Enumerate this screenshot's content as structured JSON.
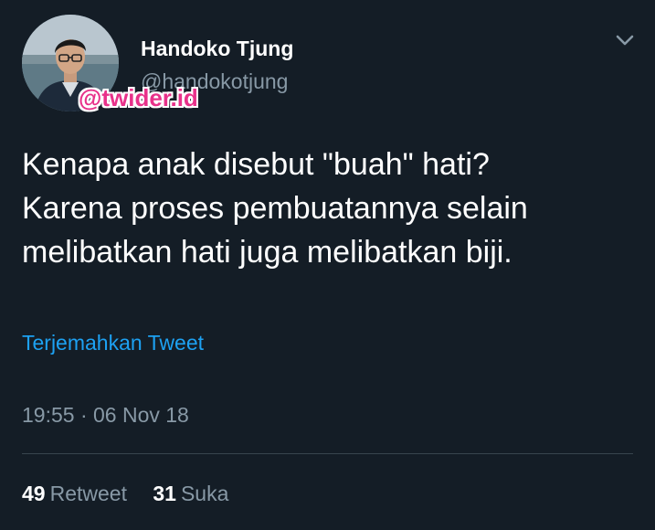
{
  "user": {
    "display_name": "Handoko Tjung",
    "handle": "@handokotjung"
  },
  "watermark": "@twider.id",
  "tweet": {
    "lines": [
      "Kenapa anak disebut \"buah\" hati?",
      "Karena proses pembuatannya selain",
      "melibatkan hati juga melibatkan biji."
    ],
    "translate_label": "Terjemahkan Tweet",
    "timestamp": "19:55 · 06 Nov 18"
  },
  "stats": {
    "retweets_count": "49",
    "retweets_label": "Retweet",
    "likes_count": "31",
    "likes_label": "Suka"
  },
  "icons": {
    "more": "chevron-down-icon"
  },
  "colors": {
    "background": "#141d26",
    "primary_text": "#ffffff",
    "secondary_text": "#8899a6",
    "link": "#1da1f2",
    "divider": "#38444d",
    "watermark": "#e8318a"
  }
}
